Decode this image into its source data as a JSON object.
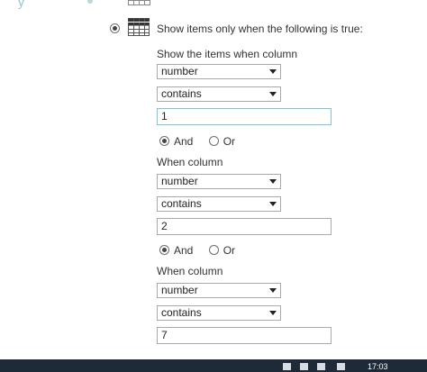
{
  "header": {
    "title": "Show items only when the following is true:"
  },
  "filter": {
    "show_items_label": "Show the items when column",
    "conditions": [
      {
        "column": "number",
        "operator": "contains",
        "value": "1"
      },
      {
        "column": "number",
        "operator": "contains",
        "value": "2"
      },
      {
        "column": "number",
        "operator": "contains",
        "value": "7"
      }
    ],
    "when_column_label": "When column",
    "and_label": "And",
    "or_label": "Or",
    "connectors": [
      "And",
      "And"
    ]
  },
  "taskbar": {
    "time": "17:03"
  }
}
